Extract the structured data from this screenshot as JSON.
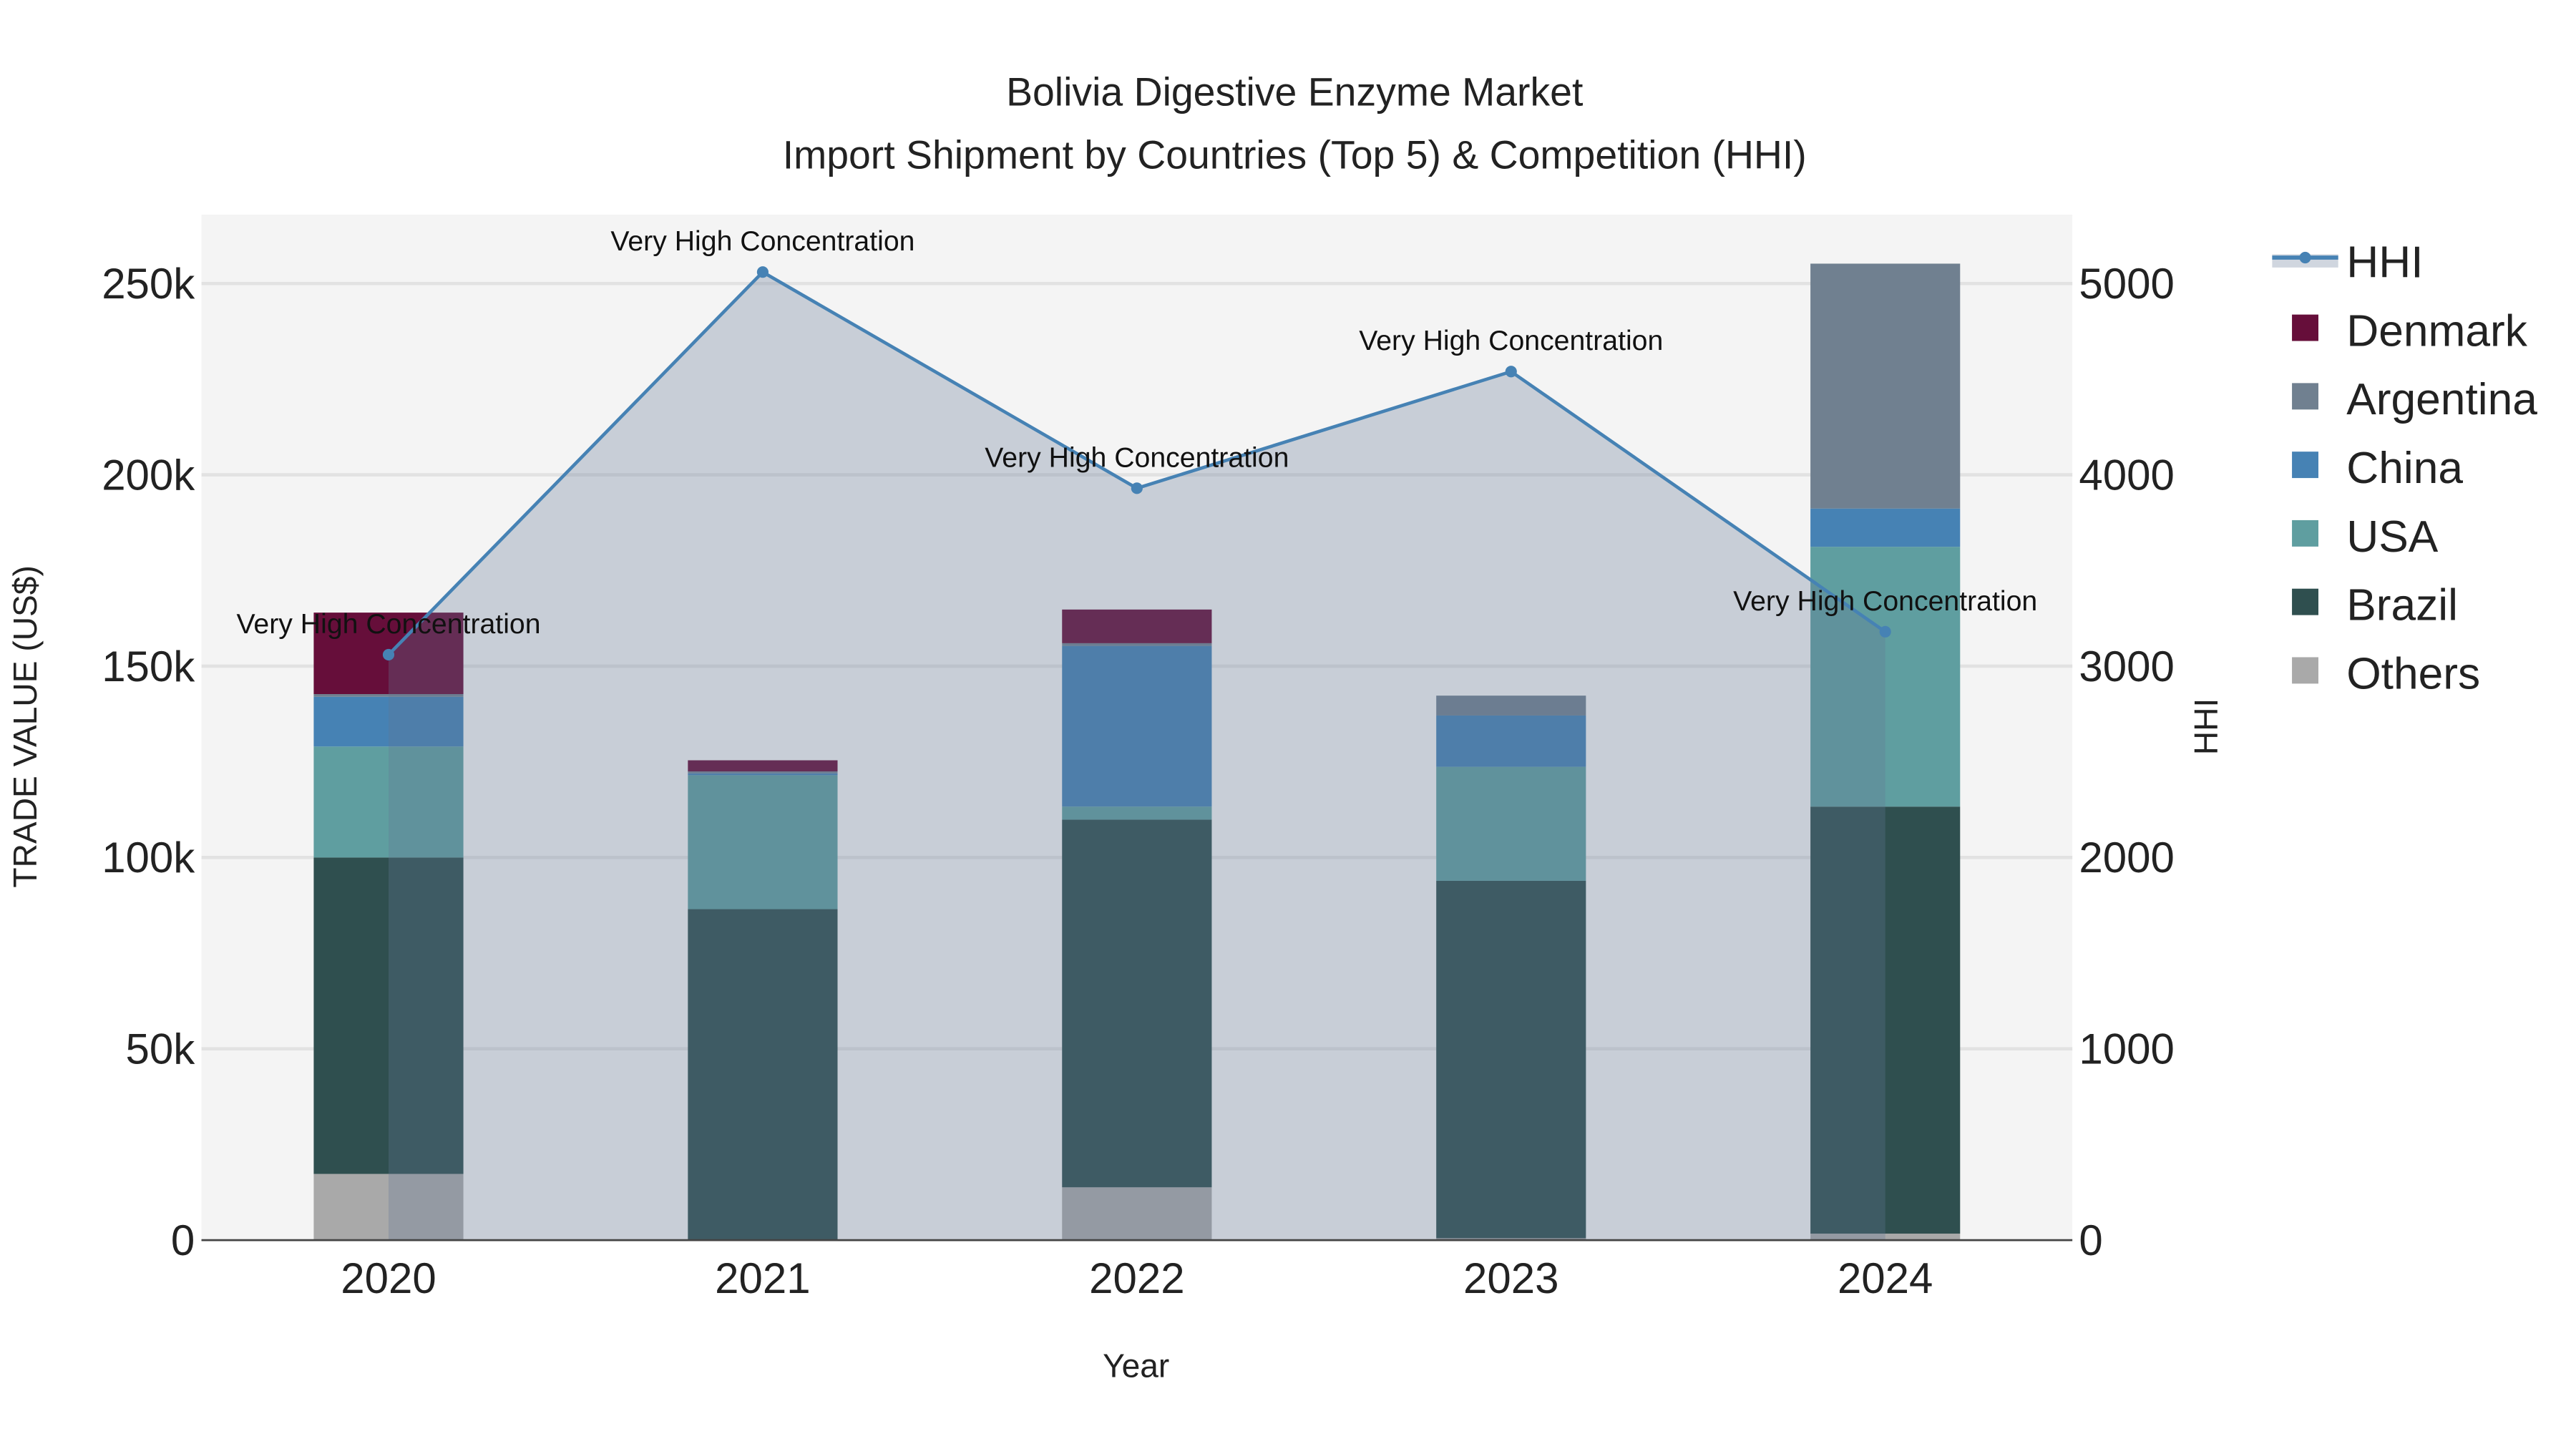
{
  "chart_data": {
    "type": "bar",
    "title_line1": "Bolivia Digestive Enzyme Market",
    "title_line2": "Import Shipment by Countries (Top 5) & Competition (HHI)",
    "xlabel": "Year",
    "ylabel": "TRADE VALUE (US$)",
    "y2label": "HHI",
    "categories": [
      "2020",
      "2021",
      "2022",
      "2023",
      "2024"
    ],
    "ylim": [
      0,
      268000
    ],
    "y2lim": [
      0,
      5360
    ],
    "yticks": [
      0,
      50000,
      100000,
      150000,
      200000,
      250000
    ],
    "ytick_labels": [
      "0",
      "50k",
      "100k",
      "150k",
      "200k",
      "250k"
    ],
    "y2ticks": [
      0,
      1000,
      2000,
      3000,
      4000,
      5000
    ],
    "y2tick_labels": [
      "0",
      "1000",
      "2000",
      "3000",
      "4000",
      "5000"
    ],
    "stacked": true,
    "series": [
      {
        "name": "Others",
        "color": "#A9A9A9",
        "values": [
          17300,
          0,
          13800,
          500,
          1700
        ]
      },
      {
        "name": "Brazil",
        "color": "#2F4F4F",
        "values": [
          82700,
          86500,
          96100,
          93400,
          111600
        ]
      },
      {
        "name": "USA",
        "color": "#5F9EA0",
        "values": [
          29000,
          35000,
          3400,
          29800,
          67900
        ]
      },
      {
        "name": "China",
        "color": "#4682B4",
        "values": [
          13000,
          500,
          42000,
          13400,
          10000
        ]
      },
      {
        "name": "Argentina",
        "color": "#708090",
        "values": [
          700,
          500,
          700,
          5200,
          64000
        ]
      },
      {
        "name": "Denmark",
        "color": "#660E3A",
        "values": [
          21300,
          2900,
          8800,
          0,
          0
        ]
      }
    ],
    "line": {
      "name": "HHI",
      "color": "#4682B4",
      "values": [
        3060,
        5060,
        3930,
        4540,
        3180
      ],
      "annotations": [
        "Very High Concentration",
        "Very High Concentration",
        "Very High Concentration",
        "Very High Concentration",
        "Very High Concentration"
      ]
    },
    "legend_order": [
      "HHI",
      "Denmark",
      "Argentina",
      "China",
      "USA",
      "Brazil",
      "Others"
    ],
    "legend_position": "right",
    "grid": true
  }
}
